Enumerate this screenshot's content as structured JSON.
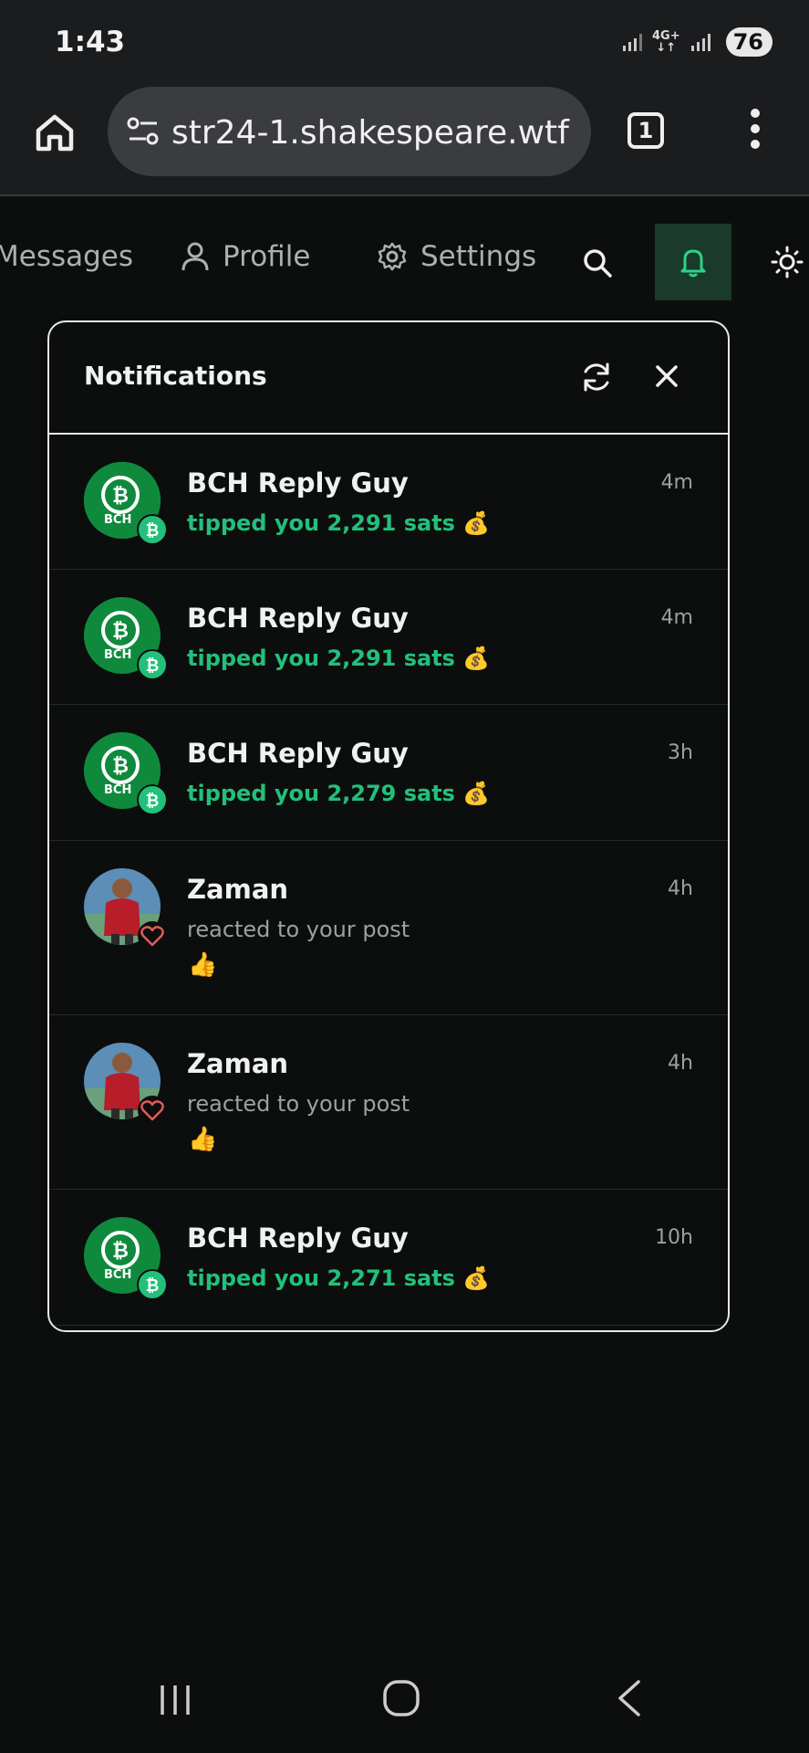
{
  "status_bar": {
    "time": "1:43",
    "network": "4G+",
    "battery": "76"
  },
  "browser": {
    "url": "str24-1.shakespeare.wtf",
    "tab_count": "1"
  },
  "nav": {
    "messages": "Messages",
    "profile": "Profile",
    "settings": "Settings"
  },
  "notifications": {
    "title": "Notifications",
    "items": [
      {
        "name": "BCH Reply Guy",
        "text": "tipped you 2,291 sats 💰",
        "time": "4m",
        "type": "zap",
        "avatar": "bch-logo",
        "avatar_label": "BCH"
      },
      {
        "name": "BCH Reply Guy",
        "text": "tipped you 2,291 sats 💰",
        "time": "4m",
        "type": "zap",
        "avatar": "bch-logo",
        "avatar_label": "BCH"
      },
      {
        "name": "BCH Reply Guy",
        "text": "tipped you 2,279 sats 💰",
        "time": "3h",
        "type": "zap",
        "avatar": "bch-logo",
        "avatar_label": "BCH"
      },
      {
        "name": "Zaman",
        "text": "reacted to your post",
        "reaction": "👍",
        "time": "4h",
        "type": "reaction",
        "avatar": "user-photo"
      },
      {
        "name": "Zaman",
        "text": "reacted to your post",
        "reaction": "👍",
        "time": "4h",
        "type": "reaction",
        "avatar": "user-photo"
      },
      {
        "name": "BCH Reply Guy",
        "text": "tipped you 2,271 sats 💰",
        "time": "10h",
        "type": "zap",
        "avatar": "bch-logo",
        "avatar_label": "BCH"
      }
    ]
  },
  "colors": {
    "accent_green": "#22c07b",
    "bch_green": "#0ac18e",
    "active_bell_bg": "#1a3a2b",
    "heart": "#e05a5a"
  }
}
